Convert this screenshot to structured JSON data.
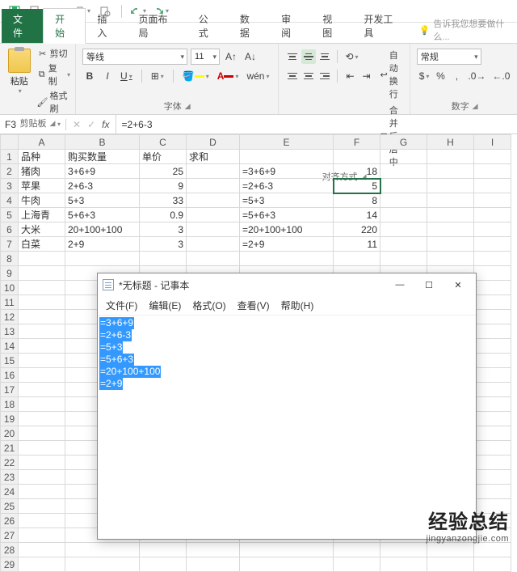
{
  "qat": {
    "icons": [
      "save",
      "new",
      "open",
      "print",
      "preview",
      "undo",
      "redo"
    ]
  },
  "tabs": {
    "file": "文件",
    "home": "开始",
    "insert": "插入",
    "pagelayout": "页面布局",
    "formulas": "公式",
    "data": "数据",
    "review": "审阅",
    "view": "视图",
    "dev": "开发工具",
    "tellme_placeholder": "告诉我您想要做什么..."
  },
  "ribbon": {
    "clipboard": {
      "label": "剪贴板",
      "paste": "粘贴",
      "cut": "剪切",
      "copy": "复制",
      "painter": "格式刷"
    },
    "font": {
      "label": "字体",
      "name": "等线",
      "size": "11"
    },
    "alignment": {
      "label": "对齐方式",
      "wrap": "自动换行",
      "merge": "合并后居中"
    },
    "number": {
      "label": "数字",
      "format": "常规"
    }
  },
  "formula_bar": {
    "cell_ref": "F3",
    "formula": "=2+6-3"
  },
  "columns": [
    "A",
    "B",
    "C",
    "D",
    "E",
    "F",
    "G",
    "H",
    "I"
  ],
  "rows": [
    {
      "n": 1,
      "A": "品种",
      "B": "购买数量",
      "C": "单价",
      "D": "求和",
      "E": "",
      "F": "",
      "num": false
    },
    {
      "n": 2,
      "A": "猪肉",
      "B": "3+6+9",
      "C": "25",
      "D": "",
      "E": "=3+6+9",
      "F": "18",
      "num": true
    },
    {
      "n": 3,
      "A": "苹果",
      "B": "2+6-3",
      "C": "9",
      "D": "",
      "E": "=2+6-3",
      "F": "5",
      "num": true
    },
    {
      "n": 4,
      "A": "牛肉",
      "B": "5+3",
      "C": "33",
      "D": "",
      "E": "=5+3",
      "F": "8",
      "num": true
    },
    {
      "n": 5,
      "A": "上海青",
      "B": "5+6+3",
      "C": "0.9",
      "D": "",
      "E": "=5+6+3",
      "F": "14",
      "num": true
    },
    {
      "n": 6,
      "A": "大米",
      "B": "20+100+100",
      "C": "3",
      "D": "",
      "E": "=20+100+100",
      "F": "220",
      "num": true
    },
    {
      "n": 7,
      "A": "白菜",
      "B": "2+9",
      "C": "3",
      "D": "",
      "E": "=2+9",
      "F": "11",
      "num": true
    }
  ],
  "empty_rows": [
    8,
    9,
    10,
    11,
    12,
    13,
    14,
    15,
    16,
    17,
    18,
    19,
    20,
    21,
    22,
    23,
    24,
    25,
    26,
    27,
    28,
    29
  ],
  "notepad": {
    "title": "*无标题 - 记事本",
    "menus": {
      "file": "文件(F)",
      "edit": "编辑(E)",
      "format": "格式(O)",
      "view": "查看(V)",
      "help": "帮助(H)"
    },
    "lines": [
      "=3+6+9",
      "=2+6-3",
      "=5+3",
      "=5+6+3",
      "=20+100+100",
      "=2+9"
    ]
  },
  "watermark": {
    "big": "经验总结",
    "small": "jingyanzongjie.com"
  }
}
